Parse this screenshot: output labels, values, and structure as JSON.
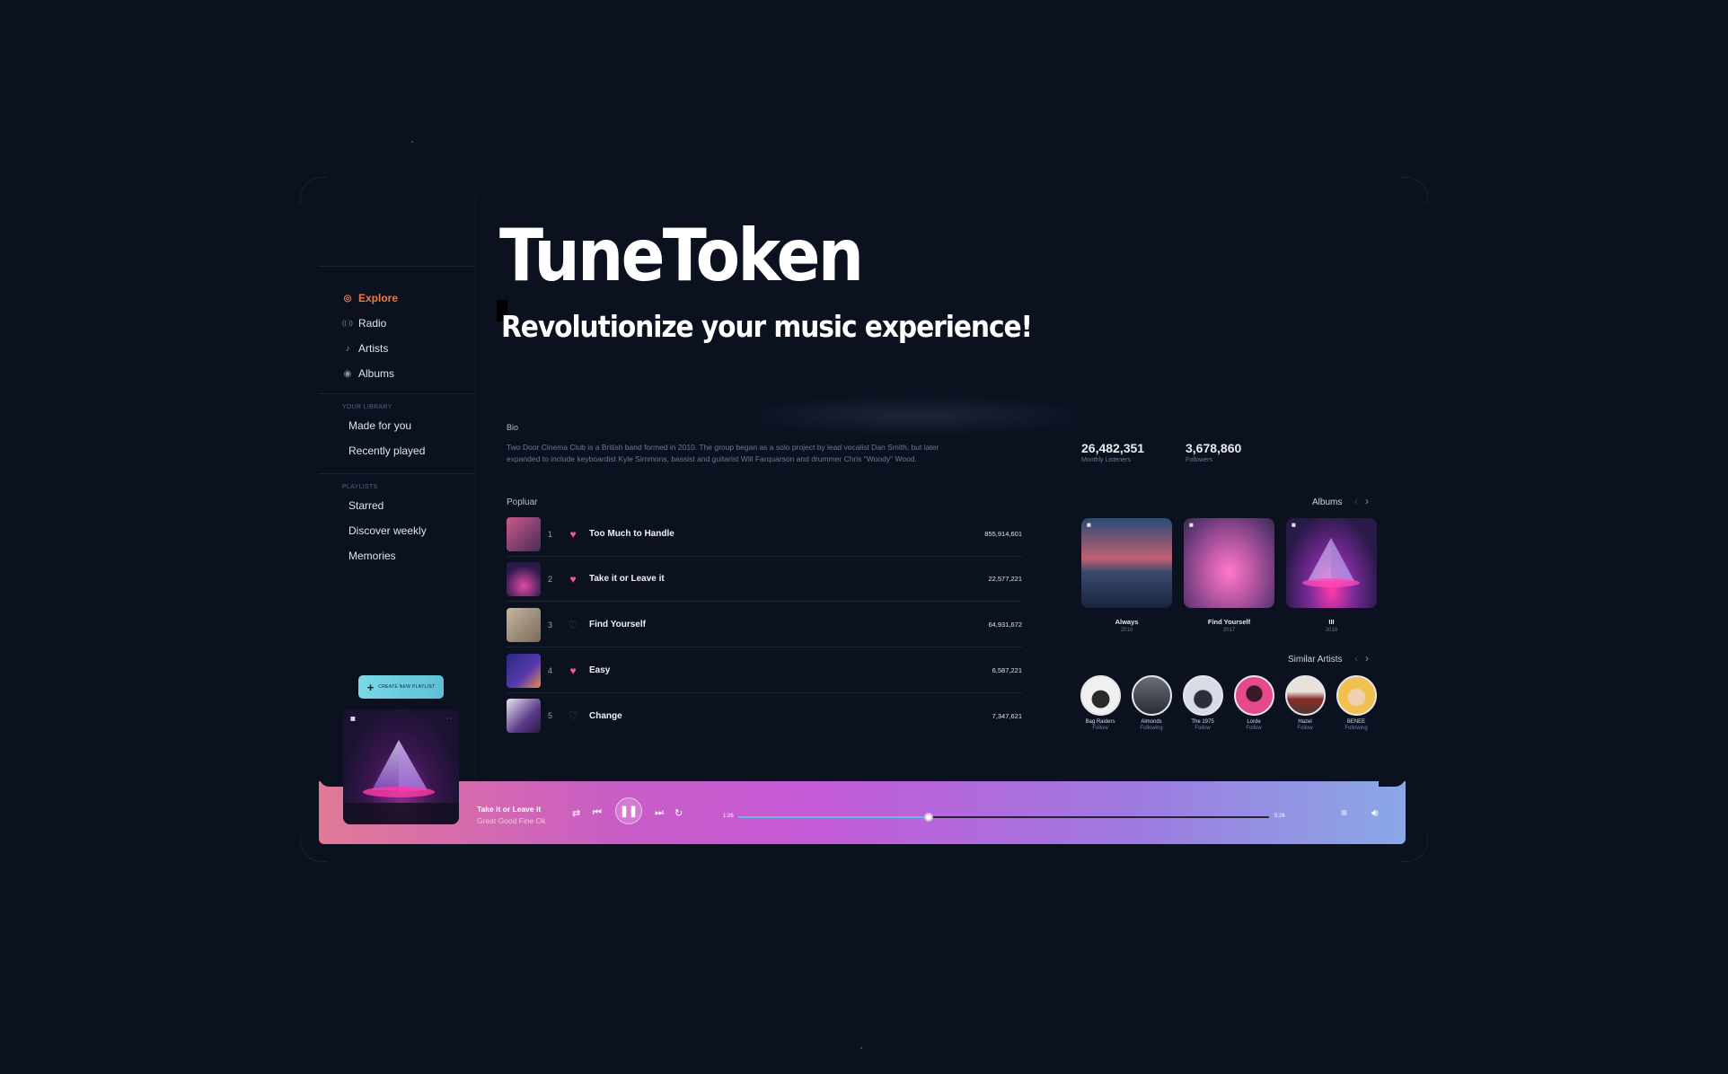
{
  "hero": {
    "title": "TuneToken",
    "subtitle": "Revolutionize your music experience!"
  },
  "sidebar": {
    "nav": [
      {
        "label": "Explore",
        "icon": "compass-icon",
        "glyph": "◎",
        "active": true
      },
      {
        "label": "Radio",
        "icon": "radio-icon",
        "glyph": "((·))",
        "active": false
      },
      {
        "label": "Artists",
        "icon": "microphone-icon",
        "glyph": "♪",
        "active": false
      },
      {
        "label": "Albums",
        "icon": "disc-icon",
        "glyph": "◉",
        "active": false
      }
    ],
    "library_title": "YOUR LIBRARY",
    "library": [
      "Made for you",
      "Recently played"
    ],
    "playlists_title": "PLAYLISTS",
    "playlists": [
      "Starred",
      "Discover weekly",
      "Memories"
    ],
    "create_button": "CREATE NEW PLAYLIST"
  },
  "bio": {
    "label": "Bio",
    "text": "Two Door Cinema Club is a British band formed in 2010. The group began as a solo project by lead vocalist Dan Smith, but later expanded to include keyboardist Kyle Simmons, bassist and guitarist Will Farquarson and drummer Chris \"Woody\" Wood."
  },
  "stats": [
    {
      "value": "26,482,351",
      "caption": "Monthly Listeners"
    },
    {
      "value": "3,678,860",
      "caption": "Followers"
    }
  ],
  "popular": {
    "label": "Popluar",
    "tracks": [
      {
        "no": "1",
        "title": "Too Much to Handle",
        "plays": "855,914,601",
        "liked": true,
        "thumb_color": "#b34b7c"
      },
      {
        "no": "2",
        "title": "Take it or Leave it",
        "plays": "22,577,221",
        "liked": true,
        "thumb_color": "#6b2e86"
      },
      {
        "no": "3",
        "title": "Find Yourself",
        "plays": "64,931,672",
        "liked": false,
        "thumb_color": "#8d7a6a"
      },
      {
        "no": "4",
        "title": "Easy",
        "plays": "6,587,221",
        "liked": true,
        "thumb_color": "#3c2a8a"
      },
      {
        "no": "5",
        "title": "Change",
        "plays": "7,347,621",
        "liked": false,
        "thumb_color": "#4a3a68"
      }
    ]
  },
  "albums": {
    "label": "Albums",
    "items": [
      {
        "name": "Always",
        "year": "2010",
        "color": "#3a5a8a"
      },
      {
        "name": "Find Yourself",
        "year": "2017",
        "color": "#d05a9a"
      },
      {
        "name": "III",
        "year": "2018",
        "color": "#7a3a9a"
      }
    ]
  },
  "similar": {
    "label": "Similar Artists",
    "items": [
      {
        "name": "Bag Raiders",
        "status": "Follow",
        "color": "#e8e8e8"
      },
      {
        "name": "Almonds",
        "status": "Following",
        "color": "#9aa0aa"
      },
      {
        "name": "The 1975",
        "status": "Follow",
        "color": "#c8ccd8"
      },
      {
        "name": "Lorde",
        "status": "Follow",
        "color": "#e0508a"
      },
      {
        "name": "Hazel",
        "status": "Follow",
        "color": "#c8c4c0"
      },
      {
        "name": "BENEE",
        "status": "Following",
        "color": "#f0c060"
      }
    ]
  },
  "player": {
    "song": "Take it or Leave it",
    "artist": "Great Good Fine Ok",
    "elapsed": "1:26",
    "total": "5:26",
    "progress": 0.36
  },
  "colors": {
    "accent": "#ef7a3d",
    "heart": "#f05a8c",
    "background": "#0c1120"
  }
}
